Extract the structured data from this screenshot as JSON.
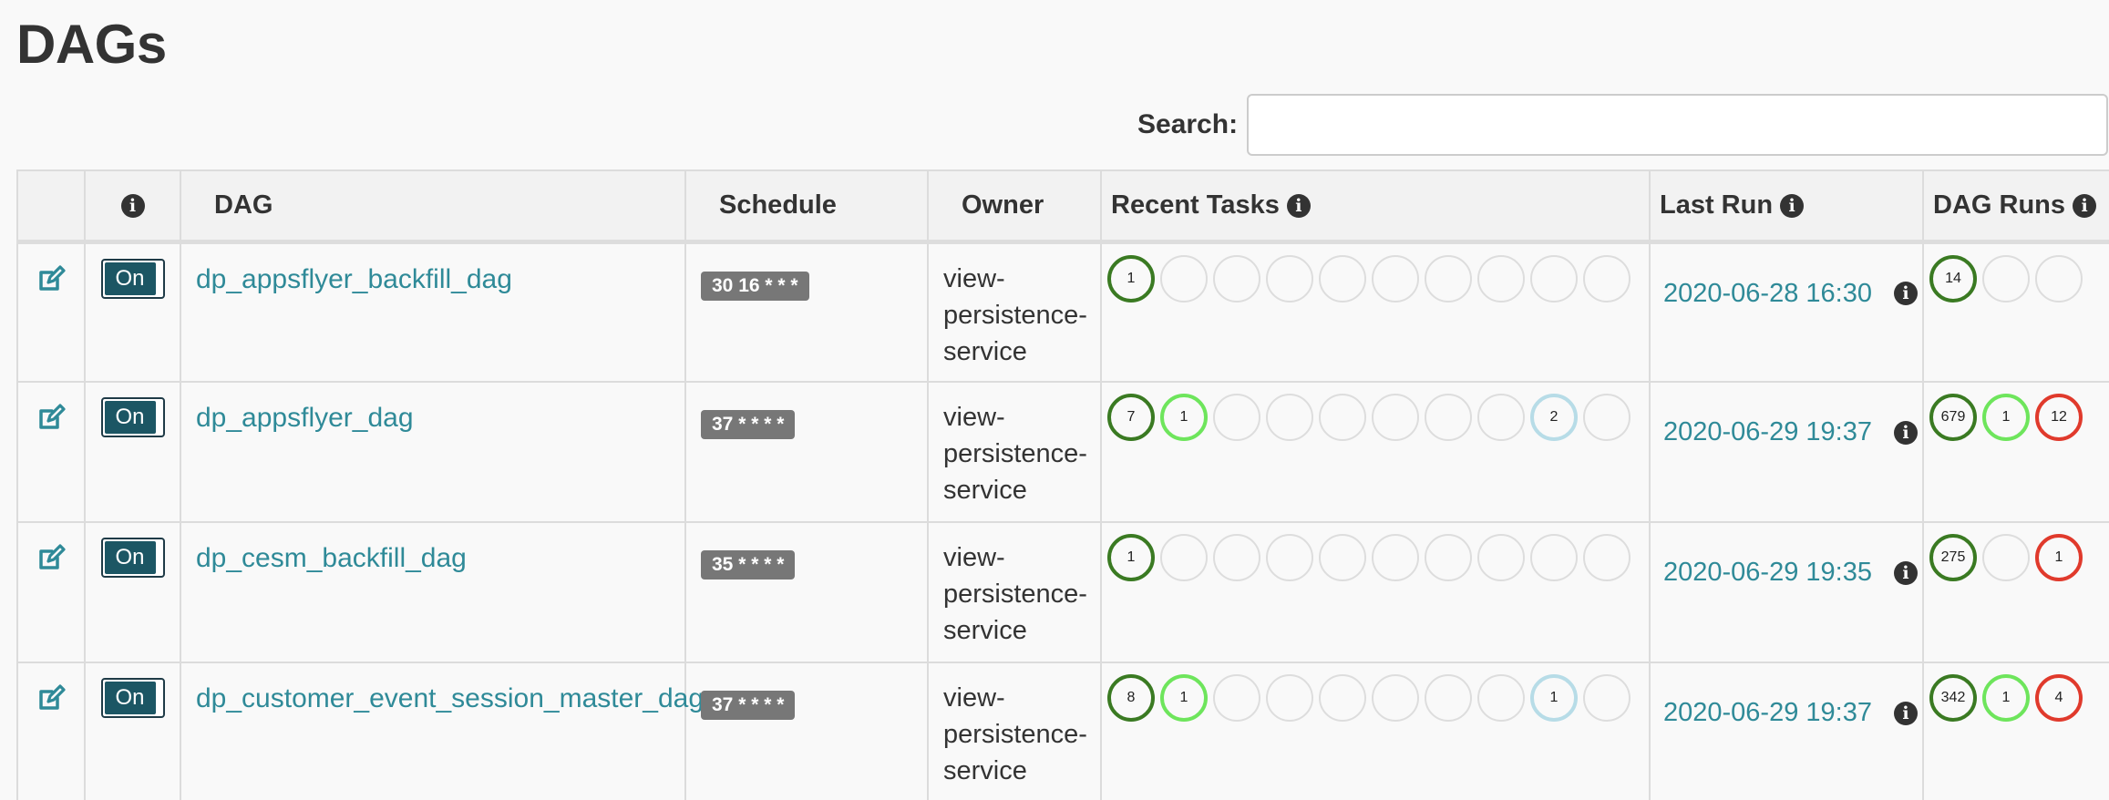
{
  "page": {
    "title": "DAGs"
  },
  "search": {
    "label": "Search:",
    "value": ""
  },
  "table": {
    "headers": {
      "info": "i",
      "dag": "DAG",
      "schedule": "Schedule",
      "owner": "Owner",
      "recent_tasks": "Recent Tasks",
      "last_run": "Last Run",
      "dag_runs": "DAG Runs"
    },
    "rows": [
      {
        "toggle": "On",
        "dag": "dp_appsflyer_backfill_dag",
        "schedule": "30 16 * * *",
        "owner": [
          "view-",
          "persistence-",
          "service"
        ],
        "recent_tasks": [
          "1",
          "",
          "",
          "",
          "",
          "",
          "",
          "",
          "",
          ""
        ],
        "last_run": "2020-06-28 16:30",
        "dag_runs": [
          "14",
          "",
          ""
        ]
      },
      {
        "toggle": "On",
        "dag": "dp_appsflyer_dag",
        "schedule": "37 * * * *",
        "owner": [
          "view-",
          "persistence-",
          "service"
        ],
        "recent_tasks": [
          "7",
          "1",
          "",
          "",
          "",
          "",
          "",
          "",
          "2",
          ""
        ],
        "last_run": "2020-06-29 19:37",
        "dag_runs": [
          "679",
          "1",
          "12"
        ]
      },
      {
        "toggle": "On",
        "dag": "dp_cesm_backfill_dag",
        "schedule": "35 * * * *",
        "owner": [
          "view-",
          "persistence-",
          "service"
        ],
        "recent_tasks": [
          "1",
          "",
          "",
          "",
          "",
          "",
          "",
          "",
          "",
          ""
        ],
        "last_run": "2020-06-29 19:35",
        "dag_runs": [
          "275",
          "",
          "1"
        ]
      },
      {
        "toggle": "On",
        "dag": "dp_customer_event_session_master_dag",
        "schedule": "37 * * * *",
        "owner": [
          "view-",
          "persistence-",
          "service"
        ],
        "recent_tasks": [
          "8",
          "1",
          "",
          "",
          "",
          "",
          "",
          "",
          "1",
          ""
        ],
        "last_run": "2020-06-29 19:37",
        "dag_runs": [
          "342",
          "1",
          "4"
        ]
      }
    ]
  },
  "colors": {
    "success": "#3a7a22",
    "running": "#6ee55c",
    "failed": "#e03a2c",
    "upstream_failed": "#b7dce7",
    "link": "#2f8a98",
    "toggle": "#1c5664"
  }
}
